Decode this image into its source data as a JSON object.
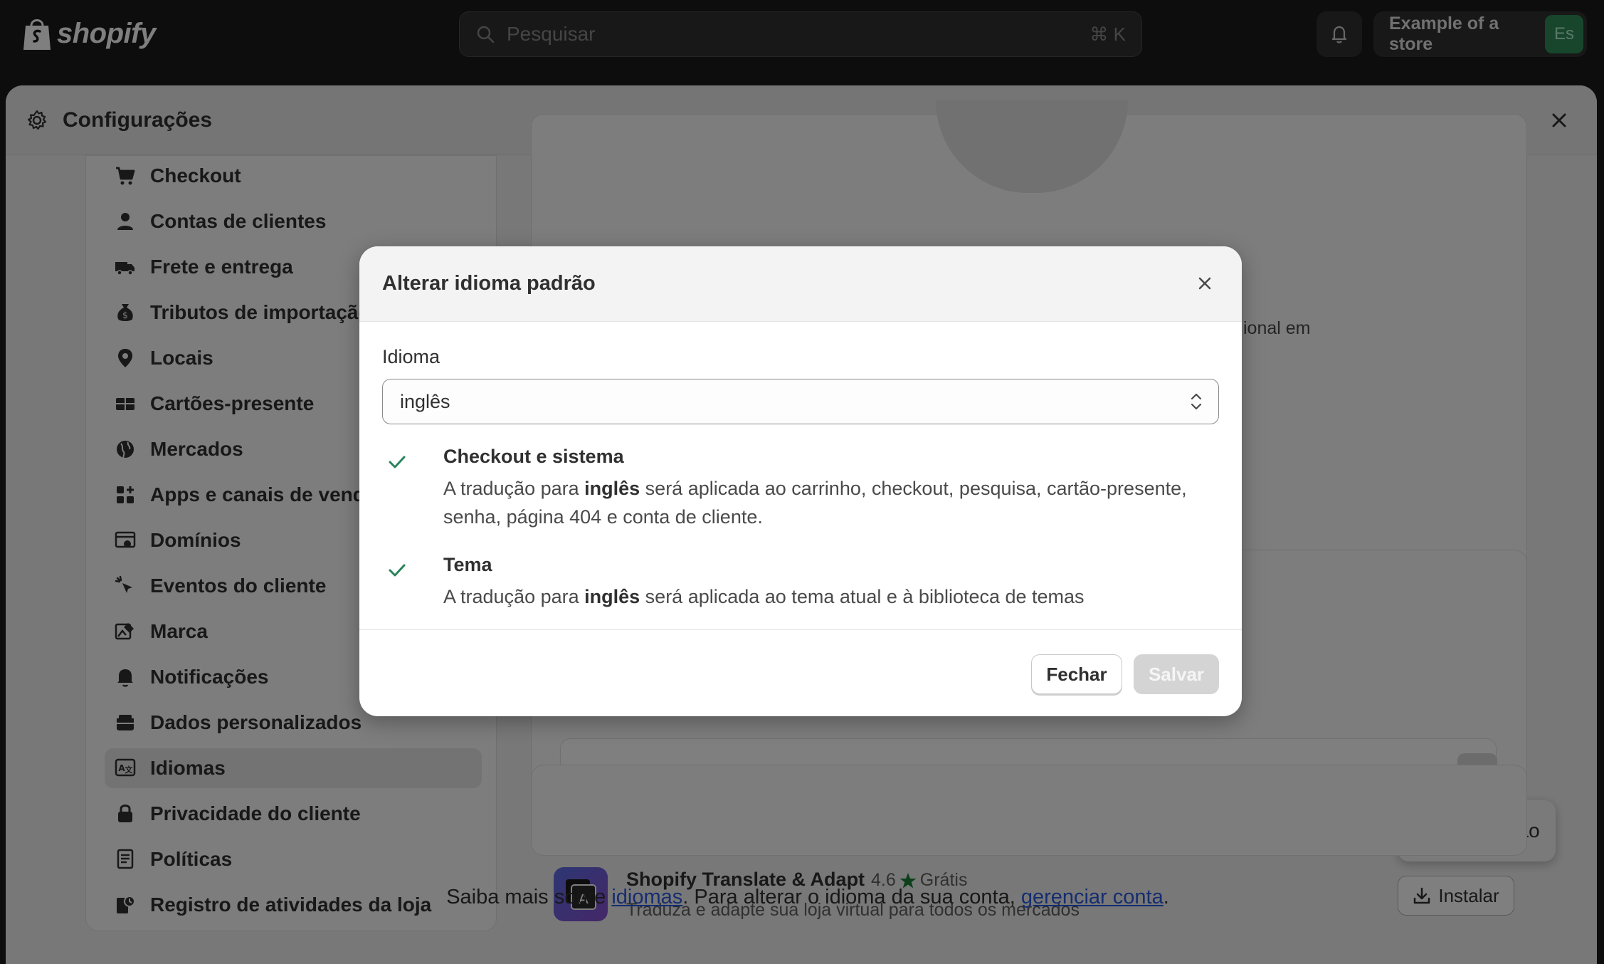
{
  "topbar": {
    "brand": "shopify",
    "search_placeholder": "Pesquisar",
    "search_shortcut": "⌘ K",
    "store_name": "Example of a store",
    "store_initials": "Es"
  },
  "panel": {
    "title": "Configurações"
  },
  "sidebar": {
    "items": [
      {
        "label": "Checkout",
        "icon": "cart-icon"
      },
      {
        "label": "Contas de clientes",
        "icon": "person-icon"
      },
      {
        "label": "Frete e entrega",
        "icon": "truck-icon"
      },
      {
        "label": "Tributos de importação",
        "icon": "money-bag-icon"
      },
      {
        "label": "Locais",
        "icon": "location-pin-icon"
      },
      {
        "label": "Cartões-presente",
        "icon": "gift-card-icon"
      },
      {
        "label": "Mercados",
        "icon": "globe-icon"
      },
      {
        "label": "Apps e canais de vendas",
        "icon": "apps-icon"
      },
      {
        "label": "Domínios",
        "icon": "domain-icon"
      },
      {
        "label": "Eventos do cliente",
        "icon": "cursor-click-icon"
      },
      {
        "label": "Marca",
        "icon": "brand-icon"
      },
      {
        "label": "Notificações",
        "icon": "bell-icon"
      },
      {
        "label": "Dados personalizados",
        "icon": "database-icon"
      },
      {
        "label": "Idiomas",
        "icon": "language-icon"
      },
      {
        "label": "Privacidade do cliente",
        "icon": "lock-icon"
      },
      {
        "label": "Políticas",
        "icon": "policy-icon"
      },
      {
        "label": "Registro de atividades da loja",
        "icon": "activity-log-icon"
      }
    ],
    "active_index": 13
  },
  "background": {
    "fragment_text": "ional em",
    "popover_label": "Alterar padrão",
    "app": {
      "name": "Shopify Translate & Adapt",
      "rating": "4.6",
      "price": "Grátis",
      "description": "Traduza e adapte sua loja virtual para todos os mercados",
      "install_label": "Instalar"
    },
    "footer": {
      "prefix": "Saiba mais sobre ",
      "link1": "idiomas",
      "middle": ". Para alterar o idioma da sua conta, ",
      "link2": "gerenciar conta",
      "suffix": "."
    }
  },
  "modal": {
    "title": "Alterar idioma padrão",
    "field_label": "Idioma",
    "selected_language": "inglês",
    "checks": [
      {
        "heading": "Checkout e sistema",
        "desc_prefix": "A tradução para ",
        "desc_bold": "inglês",
        "desc_suffix": " será aplicada ao carrinho, checkout, pesquisa, cartão-presente, senha, página 404 e conta de cliente."
      },
      {
        "heading": "Tema",
        "desc_prefix": "A tradução para ",
        "desc_bold": "inglês",
        "desc_suffix": " será aplicada ao tema atual e à biblioteca de temas"
      }
    ],
    "close_label": "Fechar",
    "save_label": "Salvar"
  },
  "colors": {
    "topbar_bg": "#1a1a1a",
    "avatar_green": "#2f8d5a",
    "check_green": "#29845a",
    "link_blue": "#2b5ae0",
    "star_green": "#1a7f37"
  }
}
